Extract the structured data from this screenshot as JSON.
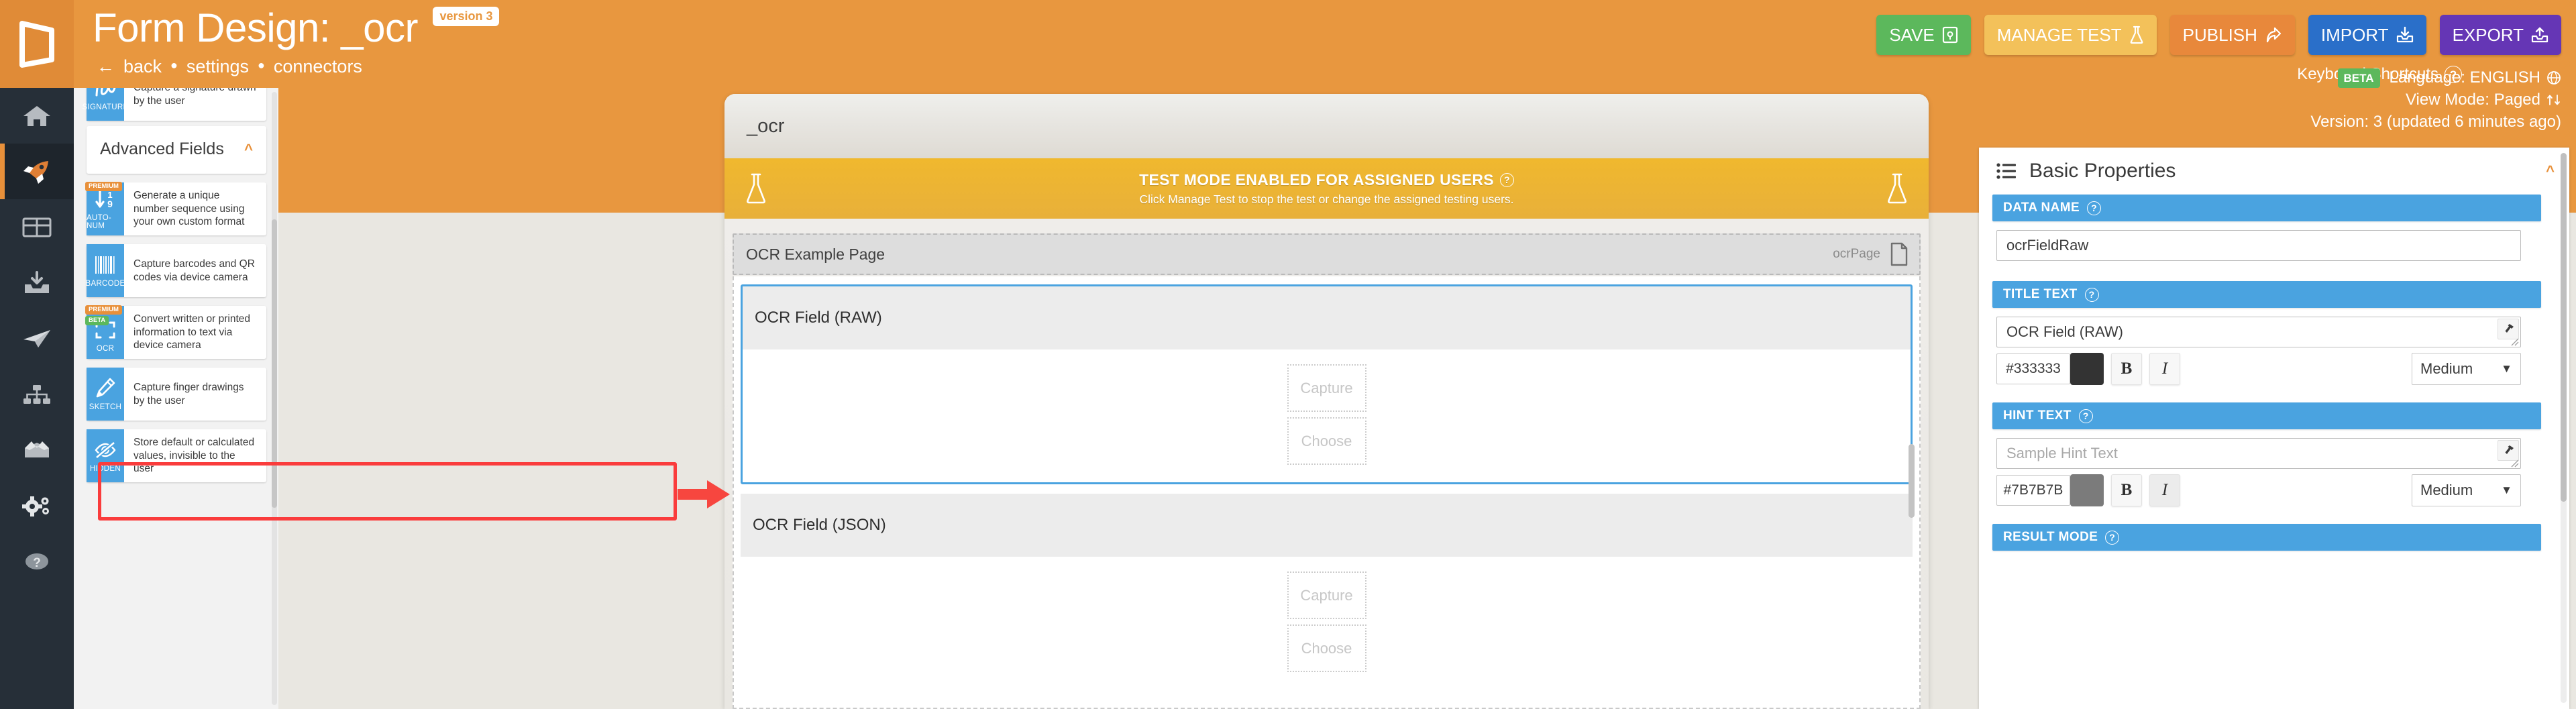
{
  "header": {
    "title": "Form Design: _ocr",
    "version_badge": "version 3",
    "breadcrumb": {
      "back": "back",
      "settings": "settings",
      "connectors": "connectors",
      "separator": "●"
    },
    "buttons": [
      {
        "label": "SAVE",
        "icon": "save-disk-icon",
        "color": "#5cb85c"
      },
      {
        "label": "MANAGE TEST",
        "icon": "flask-icon",
        "color": "#f3c15a"
      },
      {
        "label": "PUBLISH",
        "icon": "share-arrow-icon",
        "color": "#e8883b"
      },
      {
        "label": "IMPORT",
        "icon": "inbox-download-icon",
        "color": "#2a6fc9"
      },
      {
        "label": "EXPORT",
        "icon": "inbox-upload-icon",
        "color": "#6536b5"
      }
    ],
    "keyboard_shortcuts": "Keyboard Shortcuts",
    "beta_chip": "BETA",
    "language": "Language: ENGLISH",
    "view_mode": "View Mode: Paged",
    "version_info": "Version: 3 (updated 6 minutes ago)",
    "accent_color": "#e8973f"
  },
  "nav_rail": {
    "items": [
      {
        "name": "home",
        "icon": "home-icon",
        "active": false
      },
      {
        "name": "launch",
        "icon": "rocket-icon",
        "active": true
      },
      {
        "name": "data",
        "icon": "table-icon",
        "active": false
      },
      {
        "name": "inbox",
        "icon": "inbox-download-icon",
        "active": false
      },
      {
        "name": "send",
        "icon": "paper-plane-icon",
        "active": false
      },
      {
        "name": "workflow",
        "icon": "sitemap-icon",
        "active": false
      },
      {
        "name": "packages",
        "icon": "open-box-icon",
        "active": false
      },
      {
        "name": "settings",
        "icon": "gears-icon",
        "active": false
      },
      {
        "name": "help",
        "icon": "question-circle-icon",
        "active": false
      }
    ]
  },
  "left_panel": {
    "signature_field": {
      "icon_label": "SIGNATURE",
      "description": "Capture a signature drawn by the user"
    },
    "section": {
      "title": "Advanced Fields",
      "collapse_icon": "chevron-up-icon"
    },
    "fields": [
      {
        "icon_label": "AUTO-NUM",
        "description": "Generate a unique number sequence using your own custom format",
        "chips": [
          {
            "text": "PREMIUM",
            "color": "#e8903a"
          }
        ],
        "highlighted": false
      },
      {
        "icon_label": "BARCODE",
        "description": "Capture barcodes and QR codes via device camera",
        "chips": [],
        "highlighted": false
      },
      {
        "icon_label": "OCR",
        "description": "Convert written or printed information to text via device camera",
        "chips": [
          {
            "text": "PREMIUM",
            "color": "#e8903a"
          },
          {
            "text": "BETA",
            "color": "#5cb85c"
          }
        ],
        "highlighted": true
      },
      {
        "icon_label": "SKETCH",
        "description": "Capture finger drawings by the user",
        "chips": [],
        "highlighted": false
      },
      {
        "icon_label": "HIDDEN",
        "description": "Store default or calculated values, invisible to the user",
        "chips": [],
        "highlighted": false
      }
    ],
    "annotation": {
      "box_color": "#fa3c3c",
      "arrow_color": "#f7463f"
    }
  },
  "preview": {
    "form_name": "_ocr",
    "test_banner": {
      "headline": "TEST MODE ENABLED FOR ASSIGNED USERS",
      "subtext": "Click Manage Test to stop the test or change the assigned testing users."
    },
    "page": {
      "name": "OCR Example Page",
      "key": "ocrPage",
      "icon": "page-icon"
    },
    "fields": [
      {
        "title": "OCR Field (RAW)",
        "selected": true,
        "buttons": [
          "Capture",
          "Choose"
        ]
      },
      {
        "title": "OCR Field (JSON)",
        "selected": false,
        "buttons": [
          "Capture",
          "Choose"
        ]
      }
    ]
  },
  "properties": {
    "panel_title": "Basic Properties",
    "panel_icon": "list-icon",
    "collapse_icon": "chevron-up-icon",
    "sections": [
      {
        "band": "DATA NAME",
        "type": "text",
        "value": "ocrFieldRaw",
        "placeholder": ""
      },
      {
        "band": "TITLE TEXT",
        "type": "rich",
        "value": "OCR Field (RAW)",
        "placeholder": "",
        "hex": "#333333",
        "swatch_color": "#333333",
        "bold_label": "B",
        "italic_label": "I",
        "bold_active": false,
        "italic_active": false,
        "size": "Medium",
        "tool_icon": "hammer-icon"
      },
      {
        "band": "HINT TEXT",
        "type": "rich",
        "value": "",
        "placeholder": "Sample Hint Text",
        "hex": "#7B7B7B",
        "swatch_color": "#7B7B7B",
        "bold_label": "B",
        "italic_label": "I",
        "bold_active": false,
        "italic_active": true,
        "size": "Medium",
        "tool_icon": "hammer-icon"
      },
      {
        "band": "RESULT MODE",
        "type": "band-only"
      }
    ],
    "help_icon": "question-circle-icon"
  }
}
